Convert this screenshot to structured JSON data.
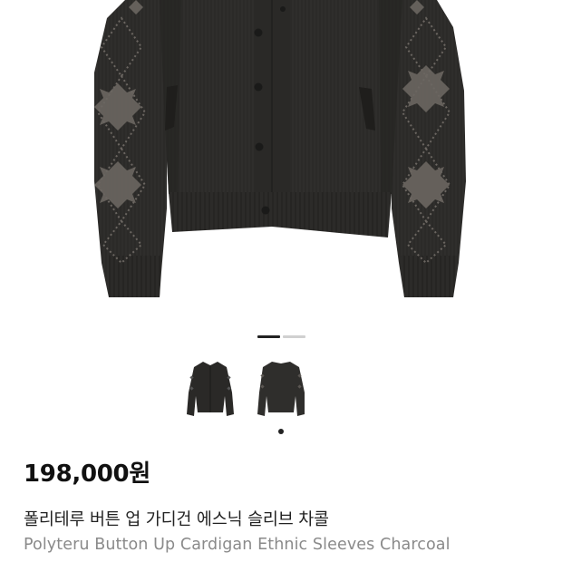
{
  "colors": {
    "garment": "#2f2e2c",
    "garment_shade": "#232220",
    "pattern": "#6b6661",
    "pager_active": "#222222",
    "pager_inactive": "#d0d0d0",
    "price": "#111111",
    "title_ko": "#222222",
    "title_en": "#8a8a8a"
  },
  "gallery": {
    "page_index": 1,
    "page_count": 2,
    "selected_thumbnail": 2
  },
  "product": {
    "price": "198,000원",
    "title_ko": "폴리테루 버튼 업 가디건 에스닉 슬리브 차콜",
    "title_en": "Polyteru Button Up Cardigan Ethnic Sleeves Charcoal"
  }
}
